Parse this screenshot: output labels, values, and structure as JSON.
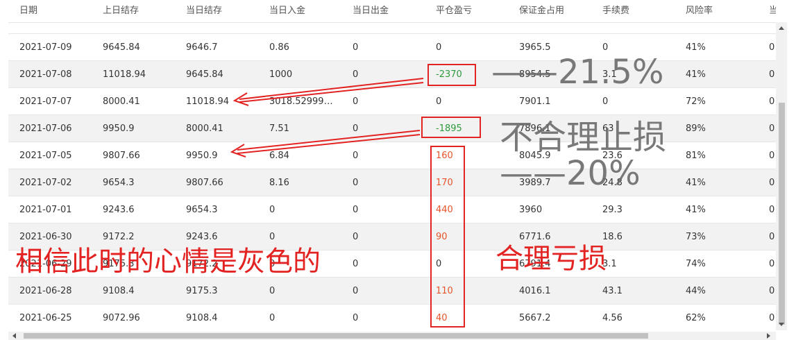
{
  "columns": [
    "日期",
    "上日结存",
    "当日结存",
    "当日入金",
    "当日出金",
    "平仓盈亏",
    "保证金占用",
    "手续费",
    "风险率",
    "当日"
  ],
  "rows": [
    {
      "date": "2021-07-09",
      "prev": "9645.84",
      "curr": "9646.7",
      "deposit": "0.86",
      "withdraw": "0",
      "pnl": "0",
      "margin": "3965.5",
      "fee": "0",
      "risk": "41%",
      "last": "0",
      "pnl_class": ""
    },
    {
      "date": "2021-07-08",
      "prev": "11018.94",
      "curr": "9645.84",
      "deposit": "1000",
      "withdraw": "0",
      "pnl": "-2370",
      "margin": "8954.5",
      "fee": "3.1",
      "risk": "41%",
      "last": "0",
      "pnl_class": "pnl-neg"
    },
    {
      "date": "2021-07-07",
      "prev": "8000.41",
      "curr": "11018.94",
      "deposit": "3018.52999…",
      "withdraw": "0",
      "pnl": "0",
      "margin": "7901.1",
      "fee": "0",
      "risk": "72%",
      "last": "0",
      "pnl_class": ""
    },
    {
      "date": "2021-07-06",
      "prev": "9950.9",
      "curr": "8000.41",
      "deposit": "7.51",
      "withdraw": "0",
      "pnl": "-1895",
      "margin": "7896.1",
      "fee": "63",
      "risk": "89%",
      "last": "0",
      "pnl_class": "pnl-neg"
    },
    {
      "date": "2021-07-05",
      "prev": "9807.66",
      "curr": "9950.9",
      "deposit": "6.84",
      "withdraw": "0",
      "pnl": "160",
      "margin": "8045.9",
      "fee": "23.6",
      "risk": "81%",
      "last": "0",
      "pnl_class": "pnl-pos"
    },
    {
      "date": "2021-07-02",
      "prev": "9654.3",
      "curr": "9807.66",
      "deposit": "8.16",
      "withdraw": "0",
      "pnl": "170",
      "margin": "3989.7",
      "fee": "24.8",
      "risk": "41%",
      "last": "0",
      "pnl_class": "pnl-pos"
    },
    {
      "date": "2021-07-01",
      "prev": "9243.6",
      "curr": "9654.3",
      "deposit": "0",
      "withdraw": "0",
      "pnl": "440",
      "margin": "3960",
      "fee": "29.3",
      "risk": "41%",
      "last": "0",
      "pnl_class": "pnl-pos"
    },
    {
      "date": "2021-06-30",
      "prev": "9172.2",
      "curr": "9243.6",
      "deposit": "0",
      "withdraw": "0",
      "pnl": "90",
      "margin": "6771.6",
      "fee": "18.6",
      "risk": "73%",
      "last": "0",
      "pnl_class": "pnl-pos"
    },
    {
      "date": "2021-06-29",
      "prev": "9175.3",
      "curr": "9172.2",
      "deposit": "0",
      "withdraw": "0",
      "pnl": "0",
      "margin": "6791.4",
      "fee": "3.1",
      "risk": "74%",
      "last": "0",
      "pnl_class": ""
    },
    {
      "date": "2021-06-28",
      "prev": "9108.4",
      "curr": "9175.3",
      "deposit": "0",
      "withdraw": "0",
      "pnl": "110",
      "margin": "4016.1",
      "fee": "43.1",
      "risk": "44%",
      "last": "0",
      "pnl_class": "pnl-pos"
    },
    {
      "date": "2021-06-25",
      "prev": "9072.96",
      "curr": "9108.4",
      "deposit": "0",
      "withdraw": "0",
      "pnl": "40",
      "margin": "5667.2",
      "fee": "4.56",
      "risk": "62%",
      "last": "0",
      "pnl_class": "pnl-pos"
    }
  ],
  "annotations": {
    "pct_21": "——21.5%",
    "unreasonable": "不合理止损",
    "pct_20": "——20%",
    "mood": "相信此时的心情是灰色的",
    "reasonable": "合理亏损"
  },
  "colors": {
    "loss_green": "#2e9a3a",
    "profit_orange": "#e8542a",
    "annotation_red": "#e32222",
    "annotation_gray": "#6b6b6b"
  }
}
